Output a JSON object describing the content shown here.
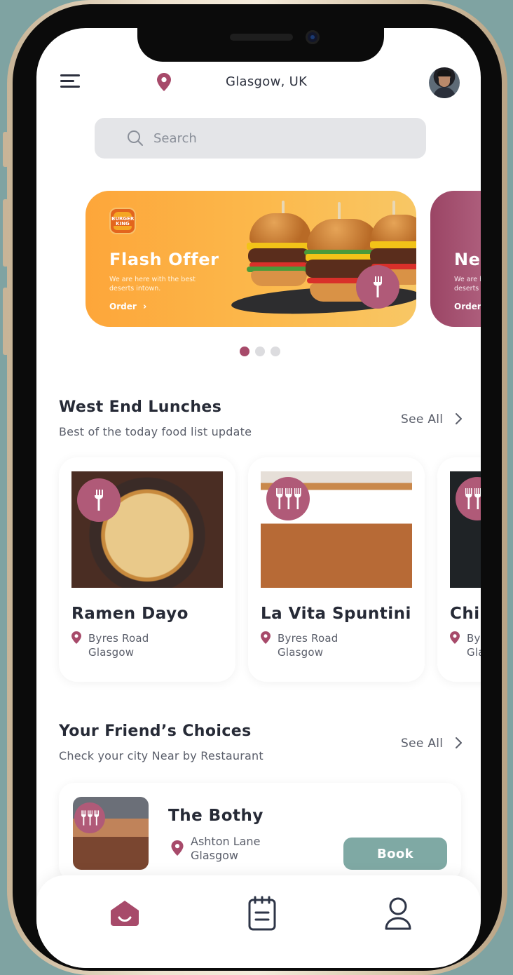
{
  "header": {
    "location": "Glasgow, UK"
  },
  "search": {
    "placeholder": "Search"
  },
  "banners": [
    {
      "brand": "BURGER KING",
      "title": "Flash Offer",
      "description": "We are here with the best deserts intown.",
      "cta": "Order"
    },
    {
      "title": "New",
      "description": "We are here with the best deserts intown.",
      "cta": "Order"
    }
  ],
  "carousel": {
    "total": 3,
    "active_index": 0
  },
  "west_end": {
    "title": "West End Lunches",
    "subtitle": "Best of the today  food list update",
    "see_all": "See All",
    "restaurants": [
      {
        "name": "Ramen Dayo",
        "street": "Byres Road",
        "city": "Glasgow"
      },
      {
        "name": "La Vita Spuntini",
        "street": "Byres Road",
        "city": "Glasgow"
      },
      {
        "name": "Chi",
        "street": "By",
        "city": "Gla"
      }
    ]
  },
  "friends": {
    "title": "Your Friend’s Choices",
    "subtitle": "Check your city Near by Restaurant",
    "see_all": "See All",
    "restaurant": {
      "name": "The Bothy",
      "street": "Ashton Lane",
      "city": "Glasgow",
      "button": "Book"
    }
  },
  "colors": {
    "accent": "#a74a6a",
    "teal": "#7fa9a4",
    "banner_orange": "#fdab3f"
  },
  "nav": [
    "home-icon",
    "orders-icon",
    "profile-icon"
  ]
}
